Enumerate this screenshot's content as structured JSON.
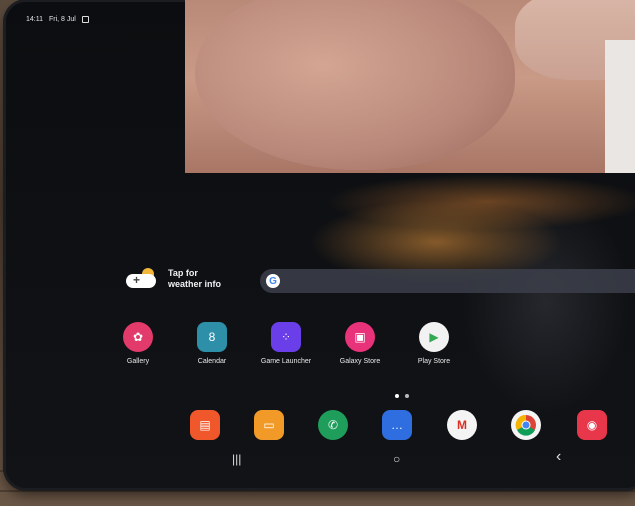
{
  "status_bar": {
    "time": "14:11",
    "date": "Fri, 8 Jul"
  },
  "weather_widget": {
    "line1": "Tap for",
    "line2": "weather info"
  },
  "search_bar": {
    "logo": "G"
  },
  "apps": [
    {
      "label": "Gallery",
      "color": "#e23a6a",
      "icon": "flower-icon"
    },
    {
      "label": "Calendar",
      "color": "#2e8fa8",
      "icon": "calendar-icon"
    },
    {
      "label": "Game Launcher",
      "color": "#6a3ee8",
      "icon": "game-icon"
    },
    {
      "label": "Galaxy Store",
      "color": "#e8327a",
      "icon": "bag-icon"
    },
    {
      "label": "Play Store",
      "color": "#f2f2f2",
      "icon": "play-icon"
    }
  ],
  "calendar_day": "8",
  "dock": [
    {
      "name": "notes",
      "color": "#f0572a",
      "icon": "notes-icon"
    },
    {
      "name": "files",
      "color": "#f29a28",
      "icon": "folder-icon"
    },
    {
      "name": "phone",
      "color": "#1e9e5a",
      "icon": "phone-icon"
    },
    {
      "name": "messages",
      "color": "#2f6ee0",
      "icon": "chat-icon"
    },
    {
      "name": "gmail",
      "color": "#f4f4f4",
      "icon": "mail-icon"
    },
    {
      "name": "chrome",
      "color": "#f4f4f4",
      "icon": "chrome-icon"
    },
    {
      "name": "camera",
      "color": "#e8364a",
      "icon": "camera-icon"
    }
  ],
  "nav": {
    "recents": "|||",
    "home": "○",
    "back": "‹"
  }
}
